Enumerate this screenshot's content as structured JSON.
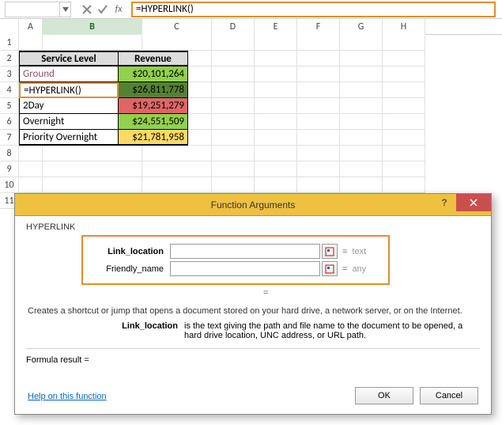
{
  "formula_bar": {
    "name_box": "",
    "formula": "=HYPERLINK()"
  },
  "columns": [
    "A",
    "B",
    "C",
    "D",
    "E",
    "F",
    "G",
    "H"
  ],
  "selected_col": "B",
  "table": {
    "headers": {
      "a": "Service Level",
      "b": "Revenue"
    },
    "rows": [
      {
        "a": "Ground",
        "b": "$20,101,264",
        "link": true,
        "color": "lgreen"
      },
      {
        "a": "=HYPERLINK()",
        "b": "$26,811,778",
        "highlight": true,
        "color": "dgreen"
      },
      {
        "a": "2Day",
        "b": "$19,251,279",
        "color": "red"
      },
      {
        "a": "Overnight",
        "b": "$24,551,509",
        "color": "lgreen"
      },
      {
        "a": "Priority Overnight",
        "b": "$21,781,958",
        "color": "yellow"
      }
    ]
  },
  "dialog": {
    "title": "Function Arguments",
    "fn_name": "HYPERLINK",
    "args": [
      {
        "label": "Link_location",
        "bold": true,
        "hint": "text"
      },
      {
        "label": "Friendly_name",
        "bold": false,
        "hint": "any"
      }
    ],
    "description": "Creates a shortcut or jump that opens a document stored on your hard drive, a network server, or on the Internet.",
    "arg_desc": {
      "label": "Link_location",
      "text": "is the text giving the path and file name to the document to be opened, a hard drive location, UNC address, or URL path."
    },
    "result_label": "Formula result =",
    "result_value": "",
    "help_link": "Help on this function",
    "ok": "OK",
    "cancel": "Cancel",
    "eq": "="
  }
}
